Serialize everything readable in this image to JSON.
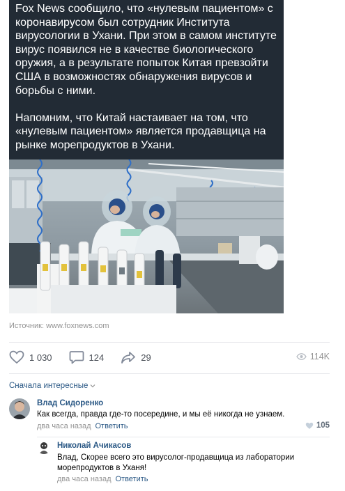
{
  "post": {
    "text_paragraphs": [
      "Fox News сообщило, что «нулевым пациентом» с коронавирусом был сотрудник Института вирусологии в Ухани. При этом в самом институте вирус появился не в качестве биологического оружия, а в результате попыток Китая превзойти США в возможностях обнаружения вирусов и борьбы с ними.",
      "Напомним, что Китай настаивает на том, что «нулевым пациентом» является продавщица на рынке морепродуктов в Ухани."
    ],
    "source_label": "Источник: www.foxnews.com"
  },
  "actions": {
    "likes": "1 030",
    "comments": "124",
    "shares": "29",
    "views": "114K"
  },
  "comments_sort": "Сначала интересные",
  "comments": [
    {
      "author": "Влад Сидоренко",
      "text": "Как всегда, правда где-то посередине, и мы её никогда не узнаем.",
      "time": "два часа назад",
      "reply_label": "Ответить",
      "likes": "105"
    },
    {
      "author": "Николай Ачикасов",
      "text": "Влад, Скорее всего это вирусолог-продавщица из лаборатории морепродуктов в Уханя!",
      "time": "два часа назад",
      "reply_label": "Ответить"
    }
  ],
  "colors": {
    "text_panel_bg": "#222b35",
    "link": "#2a5885",
    "muted": "#939393"
  }
}
